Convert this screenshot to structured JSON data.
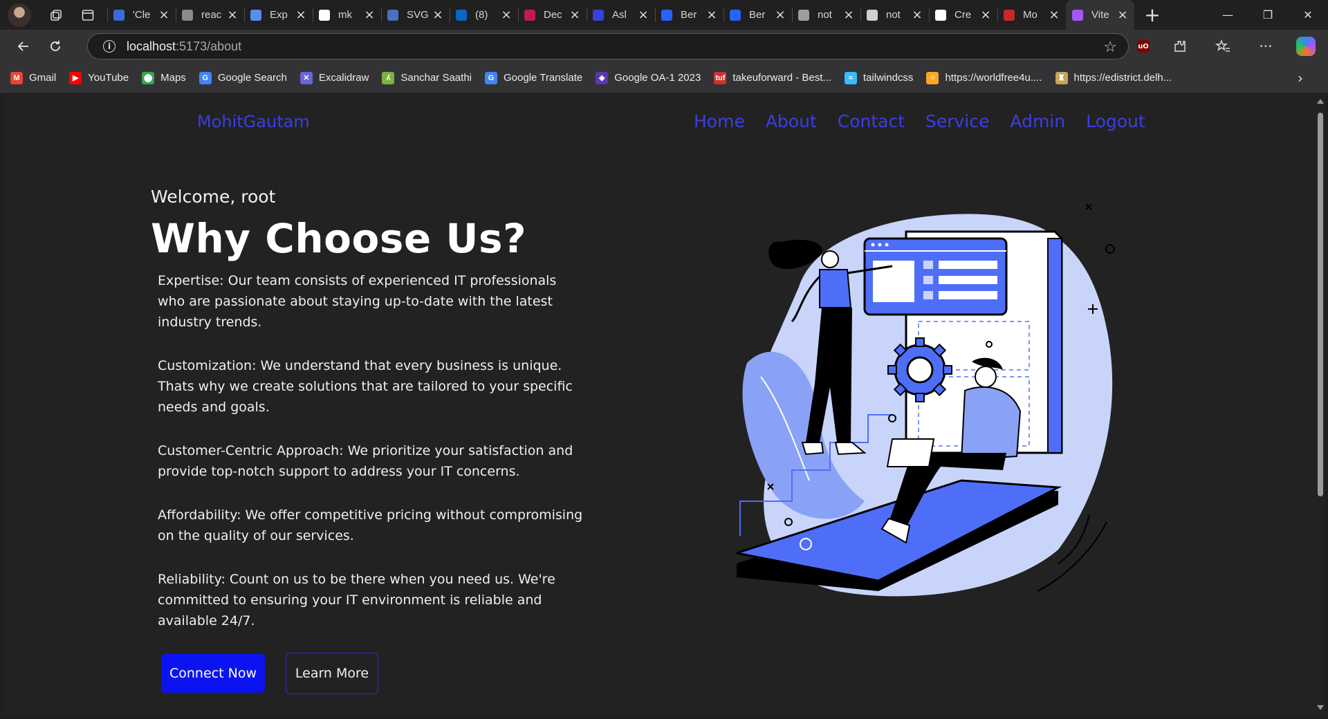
{
  "browser": {
    "tabs": [
      {
        "title": "'Cle",
        "icon": "search-icon",
        "color": "#3a6bd8"
      },
      {
        "title": "reac",
        "icon": "stackoverflow-icon",
        "color": "#8a8a8a"
      },
      {
        "title": "Exp",
        "icon": "edge-icon",
        "color": "#5b8def"
      },
      {
        "title": "mk",
        "icon": "github-icon",
        "color": "#ffffff"
      },
      {
        "title": "SVG",
        "icon": "svg-icon",
        "color": "#4a6fbf"
      },
      {
        "title": "(8)",
        "icon": "linkedin-icon",
        "color": "#0a66c2"
      },
      {
        "title": "Dec",
        "icon": "lips-icon",
        "color": "#c2185b"
      },
      {
        "title": "Asl",
        "icon": "code-icon",
        "color": "#3b3fe0"
      },
      {
        "title": "Ber",
        "icon": "grid-icon",
        "color": "#2962ff"
      },
      {
        "title": "Ber",
        "icon": "grid-icon",
        "color": "#2962ff"
      },
      {
        "title": "not",
        "icon": "document-icon",
        "color": "#9e9e9e"
      },
      {
        "title": "not",
        "icon": "triangle-icon",
        "color": "#cfcfcf"
      },
      {
        "title": "Cre",
        "icon": "triangle-icon",
        "color": "#ffffff"
      },
      {
        "title": "Mo",
        "icon": "mail-icon",
        "color": "#c62828"
      },
      {
        "title": "Vite",
        "icon": "vite-icon",
        "color": "#a855f7"
      }
    ],
    "address": {
      "host": "localhost",
      "path": ":5173/about"
    },
    "bookmarks": [
      {
        "label": "Gmail",
        "color": "#ea4335",
        "glyph": "M"
      },
      {
        "label": "YouTube",
        "color": "#ff0000",
        "glyph": "▶"
      },
      {
        "label": "Maps",
        "color": "#34a853",
        "glyph": "⬤"
      },
      {
        "label": "Google Search",
        "color": "#4285f4",
        "glyph": "G"
      },
      {
        "label": "Excalidraw",
        "color": "#6965db",
        "glyph": "✕"
      },
      {
        "label": "Sanchar Saathi",
        "color": "#7cb342",
        "glyph": "ʎ"
      },
      {
        "label": "Google Translate",
        "color": "#4285f4",
        "glyph": "G"
      },
      {
        "label": "Google OA-1 2023",
        "color": "#5e35b1",
        "glyph": "◈"
      },
      {
        "label": "takeuforward - Best...",
        "color": "#d32f2f",
        "glyph": "tuf"
      },
      {
        "label": "tailwindcss",
        "color": "#38bdf8",
        "glyph": "≈"
      },
      {
        "label": "https://worldfree4u....",
        "color": "#f9a825",
        "glyph": "⁘"
      },
      {
        "label": "https://edistrict.delh...",
        "color": "#c8a35a",
        "glyph": "♜"
      }
    ]
  },
  "site": {
    "logo": "MohitGautam",
    "nav": [
      "Home",
      "About",
      "Contact",
      "Service",
      "Admin",
      "Logout"
    ],
    "welcome": "Welcome, root",
    "headline": "Why Choose Us?",
    "points": [
      "Expertise: Our team consists of experienced IT professionals who are passionate about staying up-to-date with the latest industry trends.",
      "Customization: We understand that every business is unique. Thats why we create solutions that are tailored to your specific needs and goals.",
      "Customer-Centric Approach: We prioritize your satisfaction and provide top-notch support to address your IT concerns.",
      "Affordability: We offer competitive pricing without compromising on the quality of our services.",
      "Reliability: Count on us to be there when you need us. We're committed to ensuring your IT environment is reliable and available 24/7."
    ],
    "primary_button": "Connect Now",
    "secondary_button": "Learn More",
    "accent_color": "#3b3fe0",
    "illustration_color": "#4f6ef7"
  }
}
